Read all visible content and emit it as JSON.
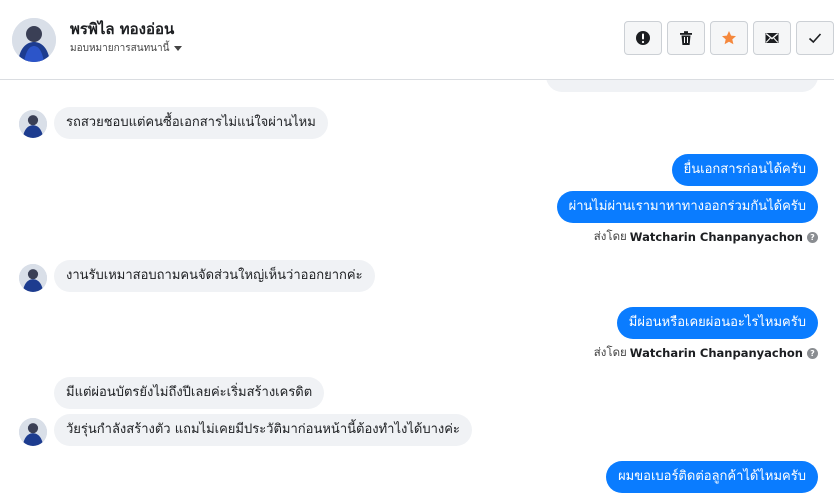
{
  "header": {
    "contact_name": "พรพิไล ทองอ่อน",
    "assign_label": "มอบหมายการสนทนานี้",
    "avatar_icon": "user-avatar-photo",
    "actions": [
      {
        "name": "spam-button",
        "icon": "exclamation-circle-icon"
      },
      {
        "name": "delete-button",
        "icon": "trash-icon"
      },
      {
        "name": "star-button",
        "icon": "star-icon",
        "color": "#f5883d"
      },
      {
        "name": "mark-unread-button",
        "icon": "envelope-icon"
      },
      {
        "name": "mark-done-button",
        "icon": "checkmark-icon"
      }
    ]
  },
  "messages": {
    "m1": "รถสวยชอบแต่คนซื้อเอกสารไม่แน่ใจผ่านไหม",
    "m2": "ยื่นเอกสารก่อนได้ครับ",
    "m3": "ผ่านไม่ผ่านเรามาหาทางออกร่วมกันได้ครับ",
    "m4": "งานรับเหมาสอบถามคนจัดส่วนใหญ่เห็นว่าออกยากค่ะ",
    "m5": "มีผ่อนหรือเคยผ่อนอะไรไหมครับ",
    "m6": "มีแต่ผ่อนบัตรยังไม่ถึงปีเลยค่ะเริ่มสร้างเครดิต",
    "m7": "วัยรุ่นกำลังสร้างตัว แถมไม่เคยมีประวัติมาก่อนหน้านี้ต้องทำไงได้บางค่ะ",
    "m8": "ผมขอเบอร์ติดต่อลูกค้าได้ไหมครับ"
  },
  "sent_by": {
    "prefix": "ส่งโดย",
    "agent": "Watcharin Chanpanyachon",
    "help_icon": "question-circle-icon"
  },
  "colors": {
    "outgoing_bubble": "#0a7cff",
    "incoming_bubble": "#f0f2f5",
    "star": "#f5883d"
  }
}
